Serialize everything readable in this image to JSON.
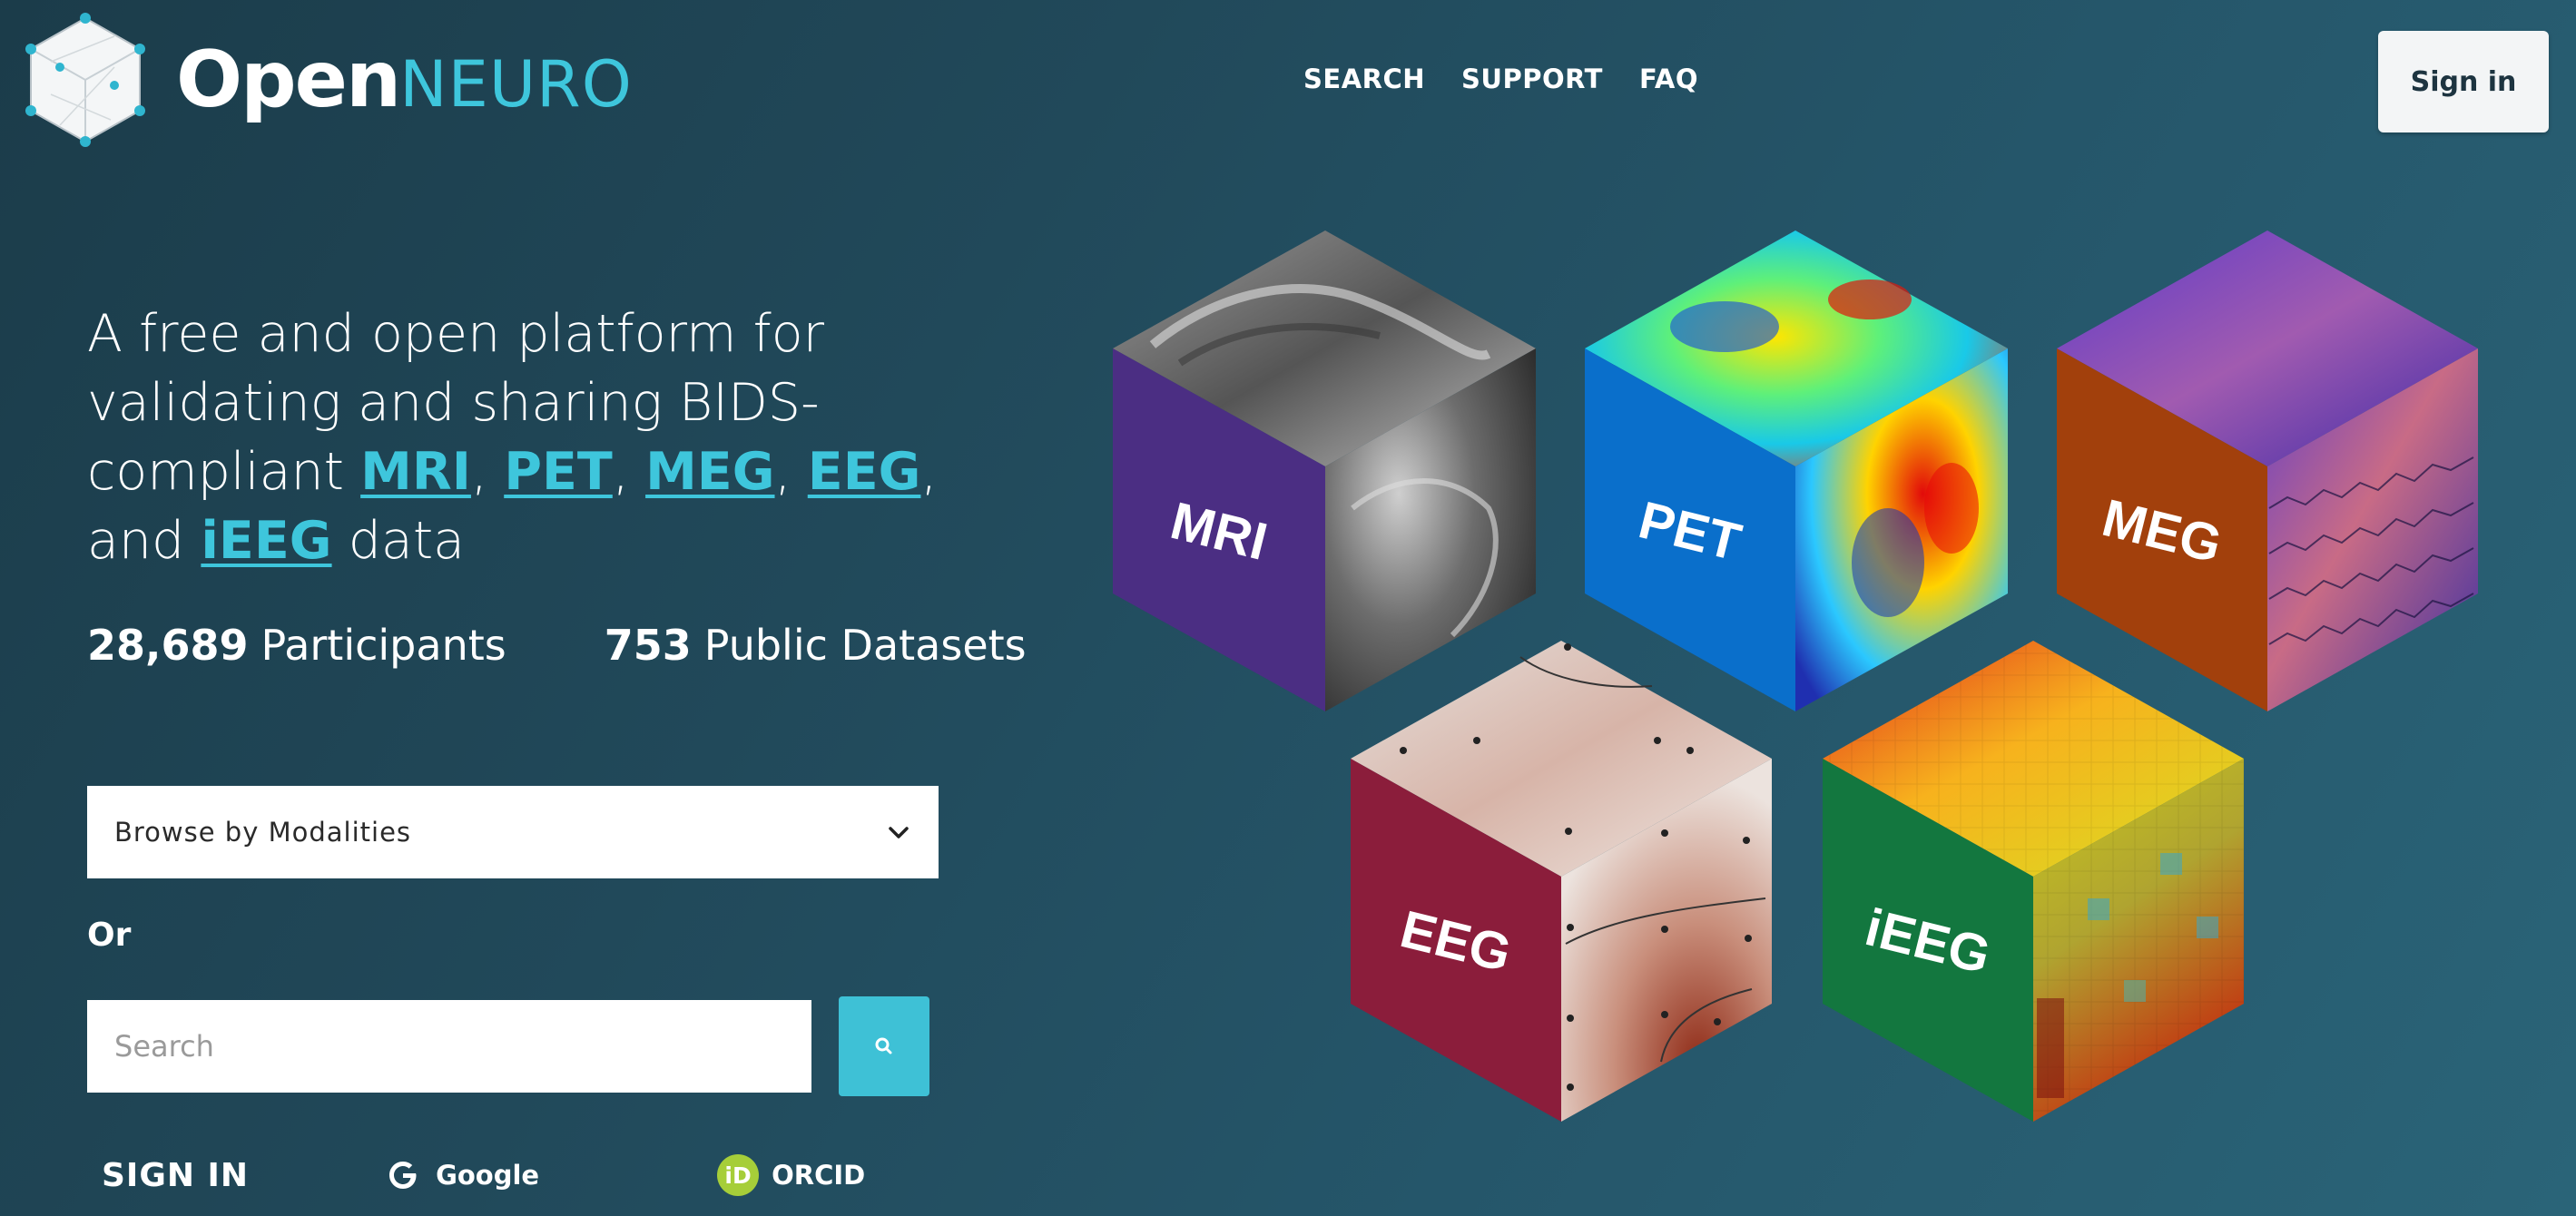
{
  "brand": {
    "name_open": "Open",
    "name_neuro": "NEURO",
    "accent_color": "#3ec6dc",
    "logo_icon": "cube-network-icon"
  },
  "nav": {
    "items": [
      {
        "label": "SEARCH"
      },
      {
        "label": "SUPPORT"
      },
      {
        "label": "FAQ"
      }
    ],
    "sign_in_label": "Sign in"
  },
  "hero": {
    "tagline_prefix": "A free and open platform for validating and sharing BIDS-compliant",
    "modalities": [
      "MRI",
      "PET",
      "MEG",
      "EEG",
      "iEEG"
    ],
    "tagline_and": ", and",
    "tagline_suffix": "data"
  },
  "stats": {
    "participants_count": "28,689",
    "participants_label": "Participants",
    "datasets_count": "753",
    "datasets_label": "Public Datasets"
  },
  "browse": {
    "selected": "Browse by Modalities",
    "icon": "chevron-down-icon"
  },
  "or_label": "Or",
  "search": {
    "placeholder": "Search",
    "icon": "search-icon"
  },
  "signin": {
    "title": "SIGN IN",
    "providers": [
      {
        "label": "Google",
        "icon": "google-icon"
      },
      {
        "label": "ORCID",
        "icon": "orcid-icon",
        "badge_text": "iD"
      }
    ]
  },
  "cubes": [
    {
      "label": "MRI",
      "side_color": "#4b2e83"
    },
    {
      "label": "PET",
      "side_color": "#0a6fcb"
    },
    {
      "label": "MEG",
      "side_color": "#a2400c"
    },
    {
      "label": "EEG",
      "side_color": "#8b1d3b"
    },
    {
      "label": "iEEG",
      "side_color": "#13773f"
    }
  ]
}
